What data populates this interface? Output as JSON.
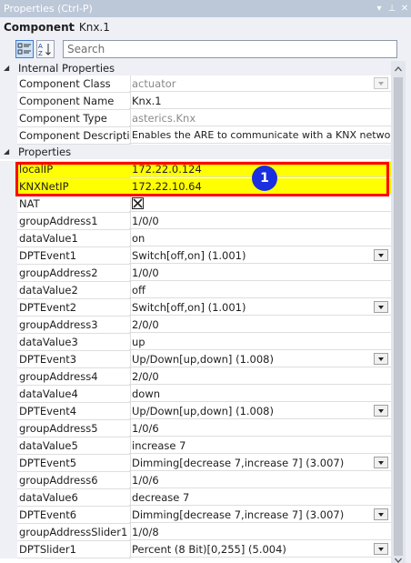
{
  "window": {
    "title": "Properties (Ctrl-P)"
  },
  "component": {
    "label": "Component",
    "name": ": Knx.1"
  },
  "search": {
    "placeholder": "Search"
  },
  "sections": {
    "internal": "Internal Properties",
    "properties": "Properties"
  },
  "internal_rows": [
    {
      "name": "Component Class",
      "value": "actuator"
    },
    {
      "name": "Component Name",
      "value": "Knx.1"
    },
    {
      "name": "Component Type",
      "value": "asterics.Knx"
    },
    {
      "name": "Component Descriptic",
      "value": "Enables the ARE to communicate with a KNX network"
    }
  ],
  "property_rows": [
    {
      "name": "localIP",
      "value": "172.22.0.124"
    },
    {
      "name": "KNXNetIP",
      "value": "172.22.10.64"
    },
    {
      "name": "NAT",
      "value": ""
    },
    {
      "name": "groupAddress1",
      "value": "1/0/0"
    },
    {
      "name": "dataValue1",
      "value": "on"
    },
    {
      "name": "DPTEvent1",
      "value": "Switch[off,on] (1.001)"
    },
    {
      "name": "groupAddress2",
      "value": "1/0/0"
    },
    {
      "name": "dataValue2",
      "value": "off"
    },
    {
      "name": "DPTEvent2",
      "value": "Switch[off,on] (1.001)"
    },
    {
      "name": "groupAddress3",
      "value": "2/0/0"
    },
    {
      "name": "dataValue3",
      "value": "up"
    },
    {
      "name": "DPTEvent3",
      "value": "Up/Down[up,down] (1.008)"
    },
    {
      "name": "groupAddress4",
      "value": "2/0/0"
    },
    {
      "name": "dataValue4",
      "value": "down"
    },
    {
      "name": "DPTEvent4",
      "value": "Up/Down[up,down] (1.008)"
    },
    {
      "name": "groupAddress5",
      "value": "1/0/6"
    },
    {
      "name": "dataValue5",
      "value": "increase 7"
    },
    {
      "name": "DPTEvent5",
      "value": "Dimming[decrease 7,increase 7] (3.007)"
    },
    {
      "name": "groupAddress6",
      "value": "1/0/6"
    },
    {
      "name": "dataValue6",
      "value": "decrease 7"
    },
    {
      "name": "DPTEvent6",
      "value": "Dimming[decrease 7,increase 7] (3.007)"
    },
    {
      "name": "groupAddressSlider1",
      "value": "1/0/8"
    },
    {
      "name": "DPTSlider1",
      "value": "Percent (8 Bit)[0,255] (5.004)"
    }
  ],
  "annotation": {
    "number": "1"
  },
  "colors": {
    "highlight": "#ffff00",
    "annotation_border": "#ff0000",
    "badge": "#1a2fe0"
  }
}
